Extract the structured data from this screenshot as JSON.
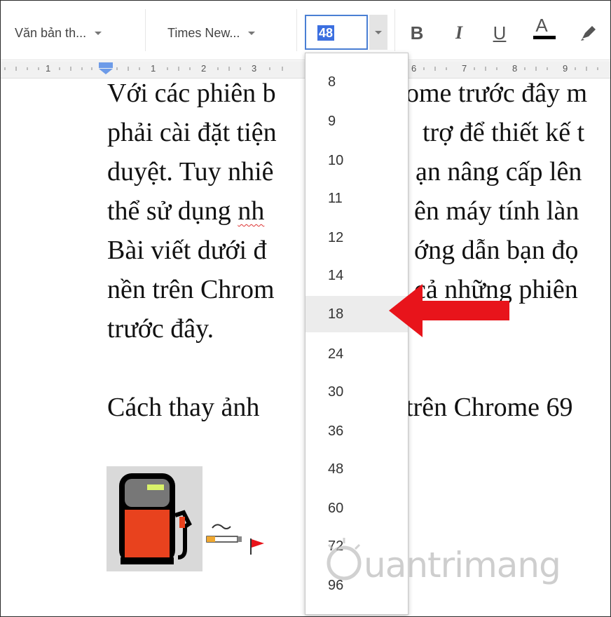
{
  "toolbar": {
    "style_select": "Văn bản th...",
    "font_select": "Times New...",
    "font_size_value": "48",
    "bold_label": "B",
    "italic_label": "I",
    "underline_label": "U",
    "text_color_label": "A",
    "text_color": "#000000",
    "highlight_icon": "marker-icon"
  },
  "ruler": {
    "numbers": [
      "1",
      "1",
      "2",
      "3",
      "6",
      "7",
      "8",
      "9"
    ]
  },
  "document": {
    "lines": [
      "Với các phiên b",
      "ome trước đây m",
      "phải cài đặt tiện",
      "trợ để thiết kế t",
      "duyệt. Tuy nhiê",
      "ạn nâng cấp lên",
      "thể sử dụng ",
      "nh",
      "ên máy tính làn",
      "Bài viết dưới đ",
      "ớng dẫn bạn đọ",
      "nền trên Chrom",
      "cả những phiên",
      "trước đây.",
      "Cách thay ảnh",
      "trên Chrome 69"
    ]
  },
  "font_size_options": [
    {
      "value": "8"
    },
    {
      "value": "9"
    },
    {
      "value": "10"
    },
    {
      "value": "11"
    },
    {
      "value": "12"
    },
    {
      "value": "14"
    },
    {
      "value": "18",
      "selected": true
    },
    {
      "value": "24"
    },
    {
      "value": "30"
    },
    {
      "value": "36"
    },
    {
      "value": "48"
    },
    {
      "value": "60"
    },
    {
      "value": "72"
    },
    {
      "value": "96"
    }
  ],
  "colors": {
    "accent": "#4a7fd4",
    "selection": "#3b6fe0",
    "annotation_arrow": "#e8141b",
    "pump_body": "#e8421e"
  },
  "watermark": {
    "text": "uantrimang",
    "icon": "lightbulb-icon"
  }
}
